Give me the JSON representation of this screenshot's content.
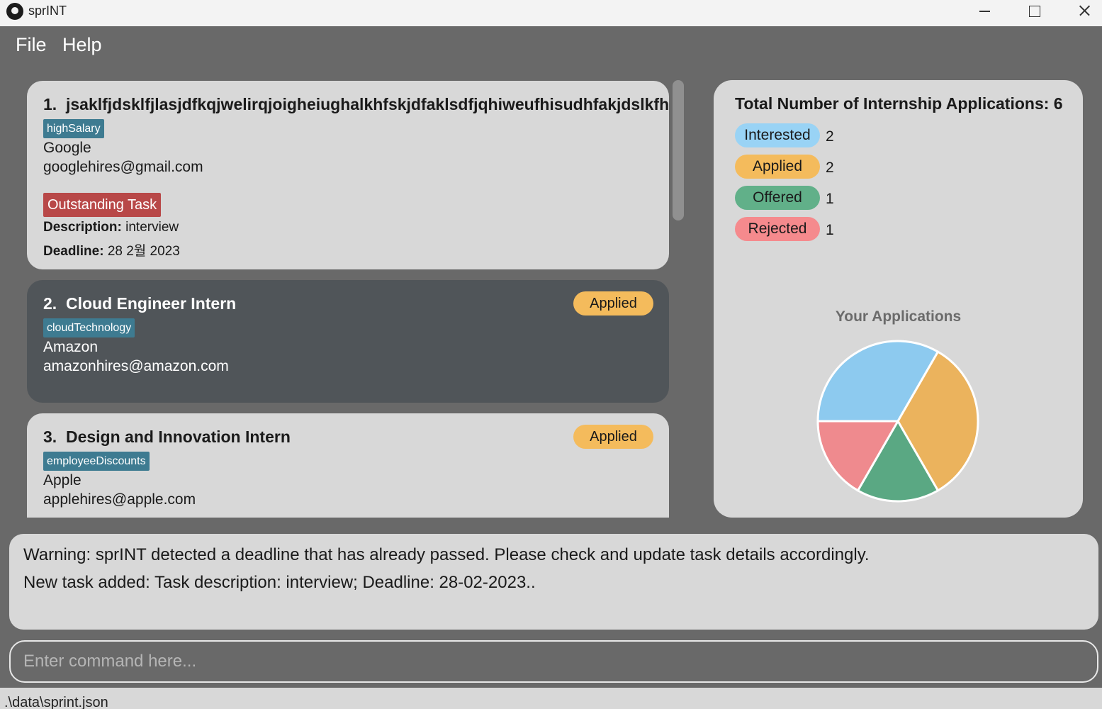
{
  "window": {
    "title": "sprINT"
  },
  "menu": {
    "file": "File",
    "help": "Help"
  },
  "applications": [
    {
      "index": "1.",
      "role": "jsaklfjdsklfjlasjdfkqjwelirqjoigheiughalkhfskjdfaklsdfjqhiweufhisudhfakjdslkfhajsdkfhaksjdhfkajshdfkjahsdf",
      "tag": "highSalary",
      "company": "Google",
      "email": "googlehires@gmail.com",
      "task": {
        "badge": "Outstanding Task",
        "description_label": "Description:",
        "description": "interview",
        "deadline_label": "Deadline:",
        "deadline": "28 2월 2023"
      }
    },
    {
      "index": "2.",
      "role": "Cloud Engineer Intern",
      "tag": "cloudTechnology",
      "company": "Amazon",
      "email": "amazonhires@amazon.com",
      "status": "Applied"
    },
    {
      "index": "3.",
      "role": "Design and Innovation Intern",
      "tag": "employeeDiscounts",
      "company": "Apple",
      "email": "applehires@apple.com",
      "status": "Applied"
    }
  ],
  "stats": {
    "total_label": "Total Number of Internship Applications: 6",
    "categories": [
      {
        "label": "Interested",
        "count": "2",
        "color": "#99d3f5"
      },
      {
        "label": "Applied",
        "count": "2",
        "color": "#f4bb5c"
      },
      {
        "label": "Offered",
        "count": "1",
        "color": "#61b089"
      },
      {
        "label": "Rejected",
        "count": "1",
        "color": "#f58a8d"
      }
    ]
  },
  "chart_data": {
    "type": "pie",
    "title": "Your Applications",
    "slices": [
      {
        "label": "Interested",
        "value": 2,
        "color": "#8dcaef"
      },
      {
        "label": "Applied",
        "value": 2,
        "color": "#ebb35d"
      },
      {
        "label": "Offered",
        "value": 1,
        "color": "#5aa883"
      },
      {
        "label": "Rejected",
        "value": 1,
        "color": "#ef8a8e"
      }
    ]
  },
  "result": {
    "line1": "Warning: sprINT detected a deadline that has already passed. Please check and update task details accordingly.",
    "line2": "New task added: Task description: interview; Deadline: 28-02-2023.."
  },
  "command": {
    "placeholder": "Enter command here..."
  },
  "status_bar": {
    "path": ".\\data\\sprint.json"
  }
}
